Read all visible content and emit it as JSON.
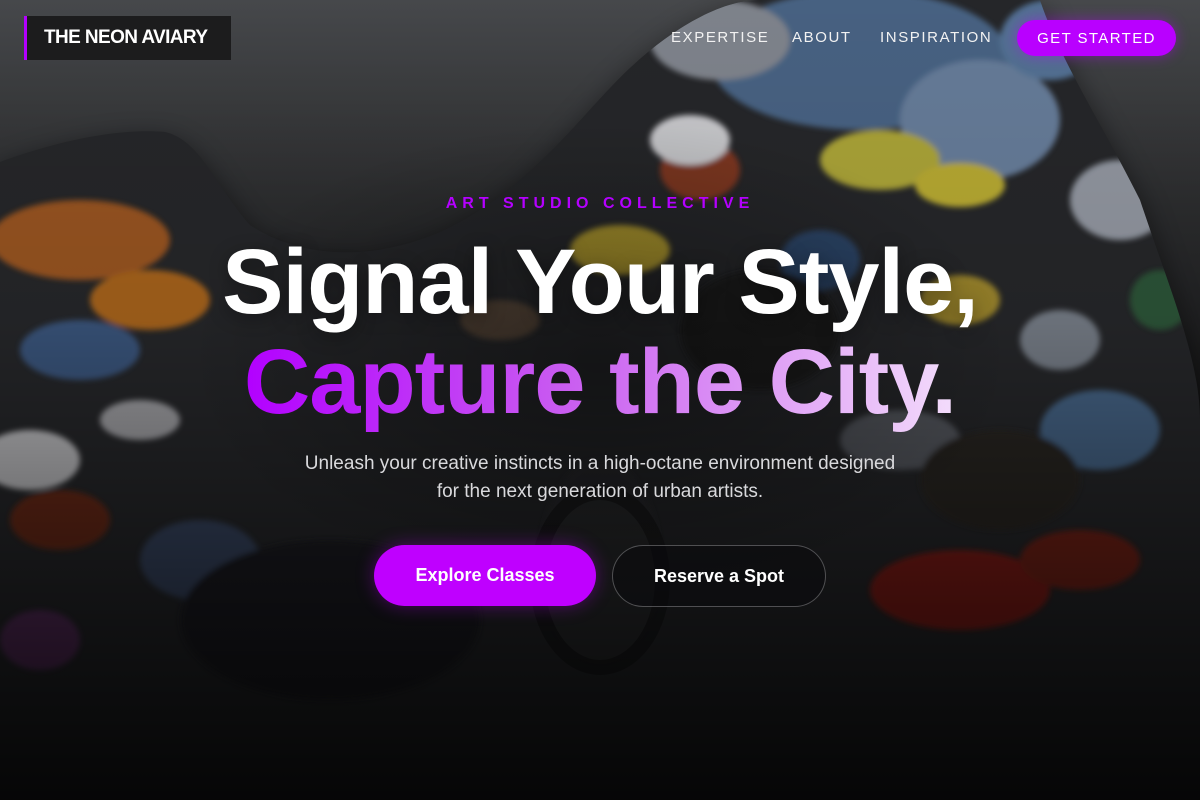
{
  "brand": {
    "name": "THE NEON AVIARY",
    "accent_color": "#b900ff"
  },
  "nav": {
    "links": [
      "EXPERTISE",
      "ABOUT",
      "INSPIRATION"
    ],
    "cta_label": "GET STARTED"
  },
  "hero": {
    "eyebrow": "ART STUDIO COLLECTIVE",
    "headline_line1": "Signal Your Style,",
    "headline_line2": "Capture the City.",
    "subtitle_line1": "Unleash your creative instincts in a high-octane environment designed",
    "subtitle_line2": "for the next generation of urban artists.",
    "primary_button": "Explore Classes",
    "secondary_button": "Reserve a Spot",
    "background_image": "paint-palette-image"
  }
}
